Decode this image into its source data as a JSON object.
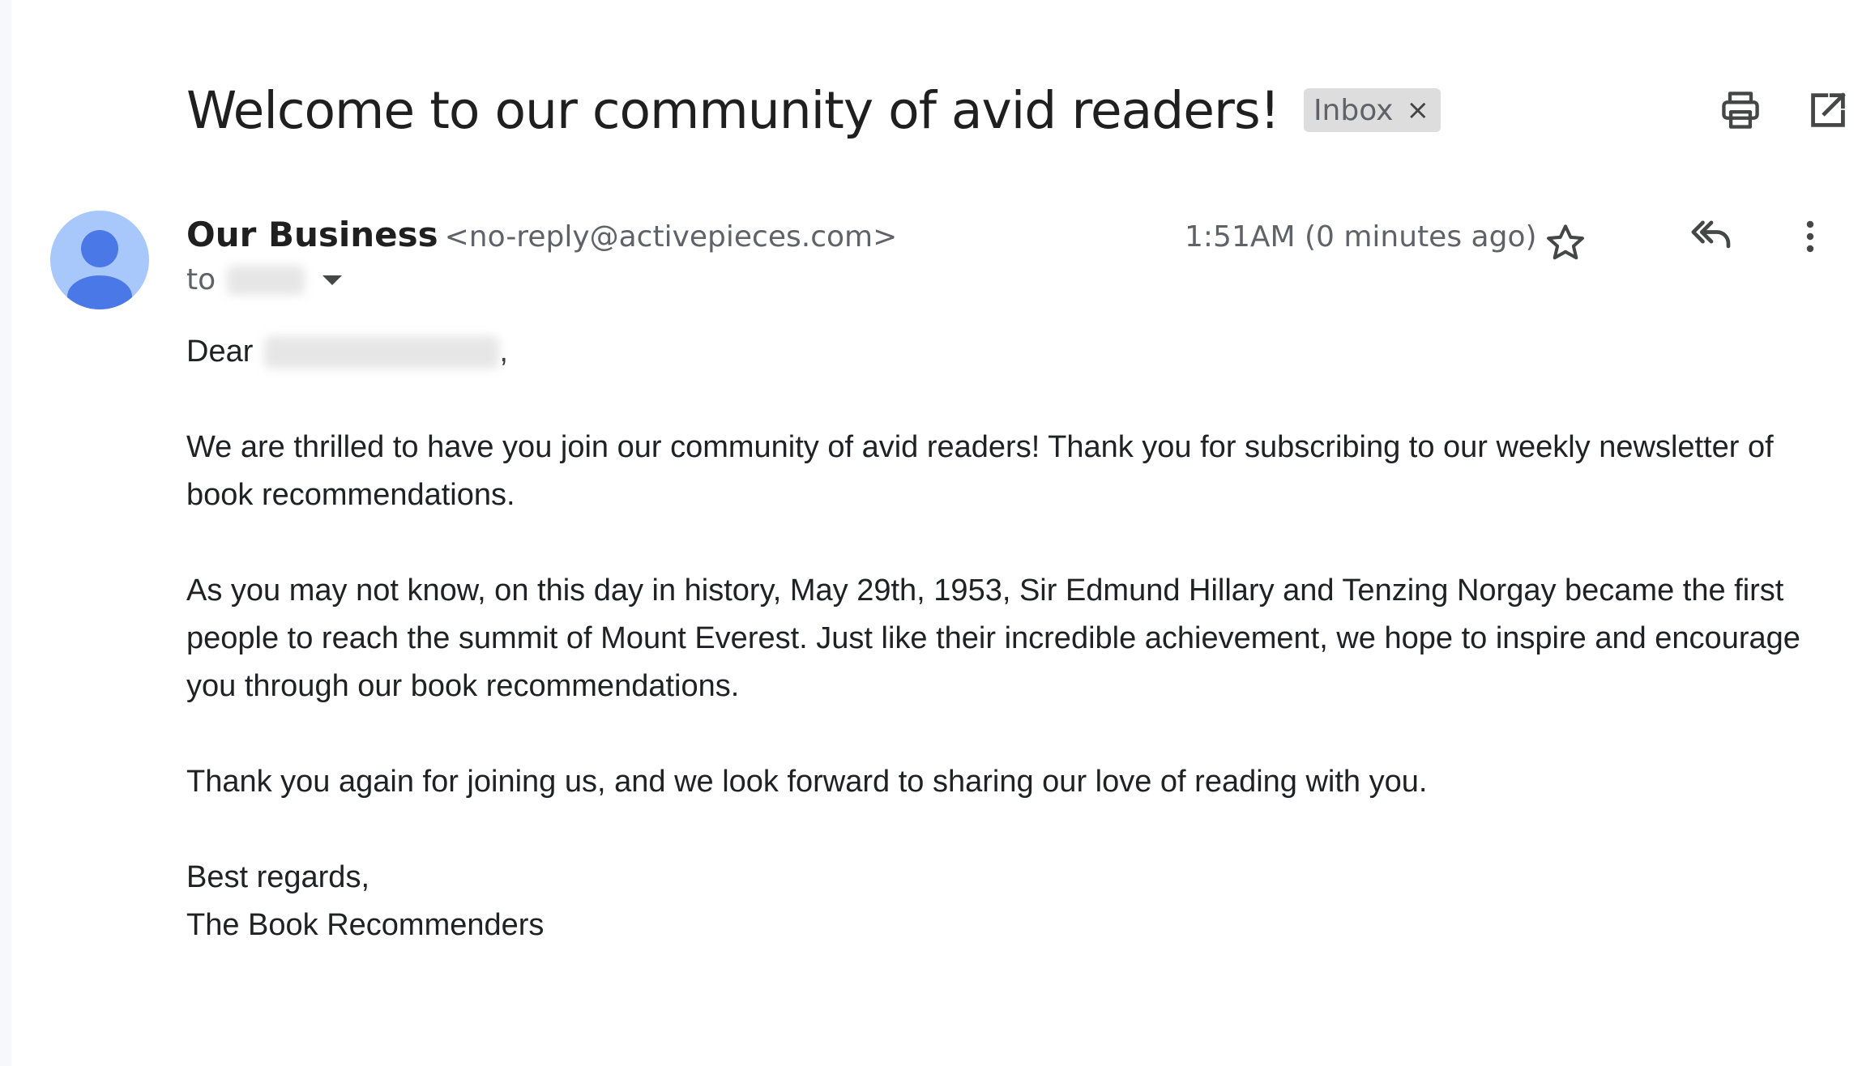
{
  "email": {
    "subject": "Welcome to our community of avid readers!",
    "label": "Inbox",
    "label_remove_glyph": "×",
    "sender_name": "Our Business",
    "sender_email": "<no-reply@activepieces.com>",
    "to_prefix": "to",
    "time": "1:51AM (0 minutes ago)",
    "greeting": "Dear",
    "greeting_comma": ",",
    "paragraphs": [
      "We are thrilled to have you join our community of avid readers! Thank you for subscribing to our weekly newsletter of book recommendations.",
      "As you may not know, on this day in history, May 29th, 1953, Sir Edmund Hillary and Tenzing Norgay became the first people to reach the summit of Mount Everest. Just like their incredible achievement, we hope to inspire and encourage you through our book recommendations.",
      "Thank you again for joining us, and we look forward to sharing our love of reading with you."
    ],
    "signoff": "Best regards,",
    "signature": "The Book Recommenders"
  },
  "icons": {
    "print": "print-icon",
    "open_new_window": "open-in-new-window-icon",
    "avatar": "person-avatar-icon",
    "star": "star-outline-icon",
    "reply_all": "reply-all-icon",
    "more": "more-vertical-icon",
    "caret": "caret-down-icon"
  },
  "colors": {
    "avatar_bg": "#a8c7fa",
    "avatar_fg": "#4a78e6",
    "label_chip": "#dddddd"
  }
}
